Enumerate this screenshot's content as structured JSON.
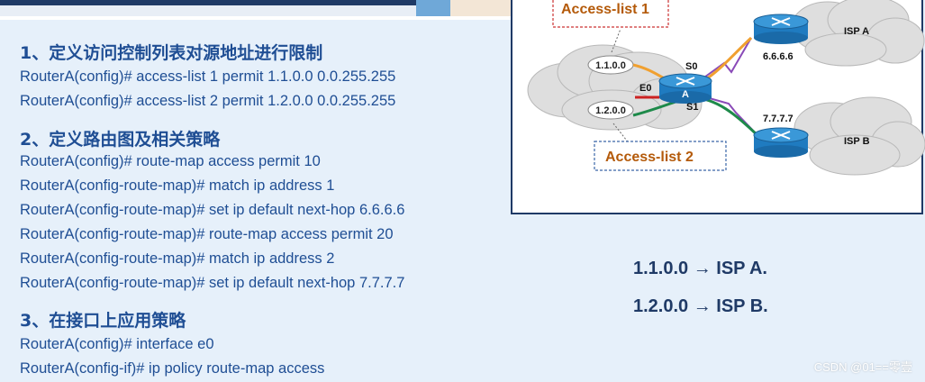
{
  "sections": [
    {
      "heading": "1、定义访问控制列表对源地址进行限制",
      "lines": [
        "RouterA(config)# access-list 1 permit  1.1.0.0 0.0.255.255",
        "RouterA(config)# access-list 2 permit  1.2.0.0 0.0.255.255"
      ]
    },
    {
      "heading": "2、定义路由图及相关策略",
      "lines": [
        "RouterA(config)# route-map access permit 10",
        "RouterA(config-route-map)# match ip address 1",
        "RouterA(config-route-map)# set ip default next-hop 6.6.6.6",
        "RouterA(config-route-map)# route-map access permit 20",
        "RouterA(config-route-map)# match ip address 2",
        "RouterA(config-route-map)# set ip default next-hop 7.7.7.7"
      ]
    },
    {
      "heading": "3、在接口上应用策略",
      "lines": [
        "RouterA(config)# interface e0",
        "RouterA(config-if)# ip policy route-map access"
      ]
    }
  ],
  "diagram": {
    "callout_1": "Access-list 1",
    "callout_2": "Access-list 2",
    "net_1": "1.1.0.0",
    "net_2": "1.2.0.0",
    "iface_s0": "S0",
    "iface_s1": "S1",
    "iface_e0": "E0",
    "router_label": "A",
    "hop_a": "6.6.6.6",
    "hop_b": "7.7.7.7",
    "isp_a": "ISP A",
    "isp_b": "ISP B",
    "colors": {
      "path_orange": "#f0a030",
      "path_green": "#1e8a4a",
      "callout_text": "#b45a0a",
      "router": "#1f7bc0"
    }
  },
  "routes": [
    "1.1.0.0 → ISP A.",
    "1.2.0.0 → ISP B."
  ],
  "watermark": "CSDN @01==零壹"
}
